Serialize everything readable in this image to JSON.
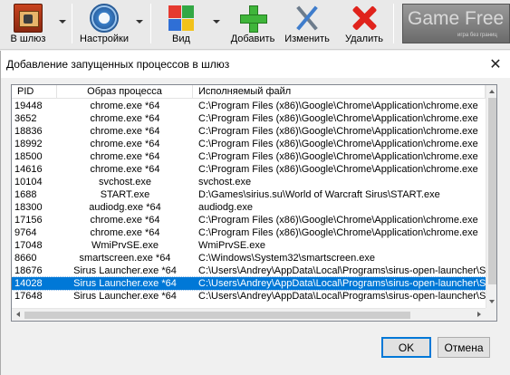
{
  "toolbar": {
    "buttons": [
      {
        "label": "В шлюз",
        "icon": "gateway-icon"
      },
      {
        "label": "Настройки",
        "icon": "settings-gear-icon"
      },
      {
        "label": "Вид",
        "icon": "view-tiles-icon"
      },
      {
        "label": "Добавить",
        "icon": "add-plus-icon"
      },
      {
        "label": "Изменить",
        "icon": "edit-tools-icon"
      },
      {
        "label": "Удалить",
        "icon": "delete-x-icon"
      }
    ],
    "banner": {
      "title": "Game Free",
      "subtitle": "игра без границ"
    }
  },
  "dialog": {
    "title": "Добавление запущенных процессов в шлюз",
    "columns": [
      "PID",
      "Образ процесса",
      "Исполняемый файл"
    ],
    "rows": [
      {
        "pid": "19448",
        "image": "chrome.exe *64",
        "path": "C:\\Program Files (x86)\\Google\\Chrome\\Application\\chrome.exe"
      },
      {
        "pid": "3652",
        "image": "chrome.exe *64",
        "path": "C:\\Program Files (x86)\\Google\\Chrome\\Application\\chrome.exe"
      },
      {
        "pid": "18836",
        "image": "chrome.exe *64",
        "path": "C:\\Program Files (x86)\\Google\\Chrome\\Application\\chrome.exe"
      },
      {
        "pid": "18992",
        "image": "chrome.exe *64",
        "path": "C:\\Program Files (x86)\\Google\\Chrome\\Application\\chrome.exe"
      },
      {
        "pid": "18500",
        "image": "chrome.exe *64",
        "path": "C:\\Program Files (x86)\\Google\\Chrome\\Application\\chrome.exe"
      },
      {
        "pid": "14616",
        "image": "chrome.exe *64",
        "path": "C:\\Program Files (x86)\\Google\\Chrome\\Application\\chrome.exe"
      },
      {
        "pid": "10104",
        "image": "svchost.exe",
        "path": "svchost.exe"
      },
      {
        "pid": "1688",
        "image": "START.exe",
        "path": "D:\\Games\\sirius.su\\World of Warcraft Sirus\\START.exe"
      },
      {
        "pid": "18300",
        "image": "audiodg.exe *64",
        "path": "audiodg.exe"
      },
      {
        "pid": "17156",
        "image": "chrome.exe *64",
        "path": "C:\\Program Files (x86)\\Google\\Chrome\\Application\\chrome.exe"
      },
      {
        "pid": "9764",
        "image": "chrome.exe *64",
        "path": "C:\\Program Files (x86)\\Google\\Chrome\\Application\\chrome.exe"
      },
      {
        "pid": "17048",
        "image": "WmiPrvSE.exe",
        "path": "WmiPrvSE.exe"
      },
      {
        "pid": "8660",
        "image": "smartscreen.exe *64",
        "path": "C:\\Windows\\System32\\smartscreen.exe"
      },
      {
        "pid": "18676",
        "image": "Sirus Launcher.exe *64",
        "path": "C:\\Users\\Andrey\\AppData\\Local\\Programs\\sirus-open-launcher\\S"
      },
      {
        "pid": "14028",
        "image": "Sirus Launcher.exe *64",
        "path": "C:\\Users\\Andrey\\AppData\\Local\\Programs\\sirus-open-launcher\\S",
        "selected": true
      },
      {
        "pid": "17648",
        "image": "Sirus Launcher.exe *64",
        "path": "C:\\Users\\Andrey\\AppData\\Local\\Programs\\sirus-open-launcher\\S"
      }
    ],
    "ok_label": "OK",
    "cancel_label": "Отмена"
  },
  "colors": {
    "selection": "#0078d7",
    "accent_border": "#0078d7"
  }
}
